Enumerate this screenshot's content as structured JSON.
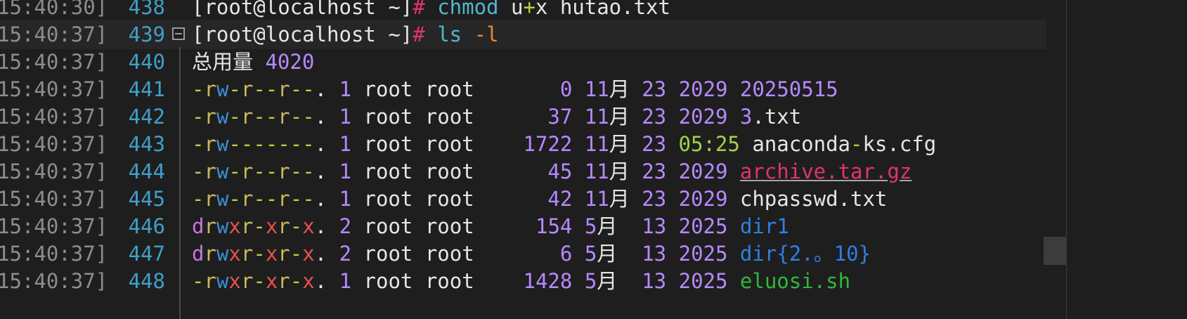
{
  "colors": {
    "background": "#1e1e1e",
    "current_line": "#262626",
    "timestamp": "#8d8d8d",
    "line_number": "#3f9fc8",
    "perm_dash": "#b6d33c",
    "perm_dir": "#c678dd",
    "perm_r": "#c8b95a",
    "perm_w": "#3a8fd8",
    "perm_x": "#e8524a",
    "number": "#b689ff",
    "text": "#e6e6e6",
    "time": "#a3d14b",
    "archive": "#e0346c",
    "directory": "#2f7fe3",
    "executable": "#2fb83a",
    "command": "#51b7cf"
  },
  "icons": {
    "fold": "fold-collapse-icon"
  },
  "lines": [
    {
      "timestamp": "15:40:30]",
      "number": "438",
      "tokens": [
        {
          "t": "[root@localhost ~]",
          "c": "wh"
        },
        {
          "t": "#",
          "c": "red"
        },
        {
          "t": " ",
          "c": "wh"
        },
        {
          "t": "chmod",
          "c": "cyan"
        },
        {
          "t": " u",
          "c": "wh"
        },
        {
          "t": "+",
          "c": "dash"
        },
        {
          "t": "x hutao.txt",
          "c": "wh"
        }
      ]
    },
    {
      "timestamp": "15:40:37]",
      "number": "439",
      "current": true,
      "tokens": [
        {
          "t": "[root@localhost ~]",
          "c": "wh"
        },
        {
          "t": "#",
          "c": "red"
        },
        {
          "t": " ",
          "c": "wh"
        },
        {
          "t": "ls",
          "c": "cyan"
        },
        {
          "t": " ",
          "c": "wh"
        },
        {
          "t": "-l",
          "c": "orange"
        }
      ]
    },
    {
      "timestamp": "15:40:37]",
      "number": "440",
      "tokens": [
        {
          "t": "总用量 ",
          "c": "wh"
        },
        {
          "t": "4020",
          "c": "pu"
        }
      ]
    },
    {
      "timestamp": "15:40:37]",
      "number": "441",
      "tokens": [
        {
          "t": "-",
          "c": "dash"
        },
        {
          "t": "r",
          "c": "r"
        },
        {
          "t": "w",
          "c": "w"
        },
        {
          "t": "-",
          "c": "dash"
        },
        {
          "t": "r",
          "c": "r"
        },
        {
          "t": "--",
          "c": "dash"
        },
        {
          "t": "r",
          "c": "r"
        },
        {
          "t": "--",
          "c": "dash"
        },
        {
          "t": ". ",
          "c": "wh"
        },
        {
          "t": "1",
          "c": "pu"
        },
        {
          "t": " root root       ",
          "c": "wh"
        },
        {
          "t": "0",
          "c": "pu"
        },
        {
          "t": " ",
          "c": "wh"
        },
        {
          "t": "11",
          "c": "pu"
        },
        {
          "t": "月 ",
          "c": "wh"
        },
        {
          "t": "23",
          "c": "pu"
        },
        {
          "t": " ",
          "c": "wh"
        },
        {
          "t": "2029",
          "c": "pu"
        },
        {
          "t": " ",
          "c": "wh"
        },
        {
          "t": "20250515",
          "c": "pu"
        }
      ]
    },
    {
      "timestamp": "15:40:37]",
      "number": "442",
      "tokens": [
        {
          "t": "-",
          "c": "dash"
        },
        {
          "t": "r",
          "c": "r"
        },
        {
          "t": "w",
          "c": "w"
        },
        {
          "t": "-",
          "c": "dash"
        },
        {
          "t": "r",
          "c": "r"
        },
        {
          "t": "--",
          "c": "dash"
        },
        {
          "t": "r",
          "c": "r"
        },
        {
          "t": "--",
          "c": "dash"
        },
        {
          "t": ". ",
          "c": "wh"
        },
        {
          "t": "1",
          "c": "pu"
        },
        {
          "t": " root root      ",
          "c": "wh"
        },
        {
          "t": "37",
          "c": "pu"
        },
        {
          "t": " ",
          "c": "wh"
        },
        {
          "t": "11",
          "c": "pu"
        },
        {
          "t": "月 ",
          "c": "wh"
        },
        {
          "t": "23",
          "c": "pu"
        },
        {
          "t": " ",
          "c": "wh"
        },
        {
          "t": "2029",
          "c": "pu"
        },
        {
          "t": " ",
          "c": "wh"
        },
        {
          "t": "3",
          "c": "pu"
        },
        {
          "t": ".txt",
          "c": "wh"
        }
      ]
    },
    {
      "timestamp": "15:40:37]",
      "number": "443",
      "tokens": [
        {
          "t": "-",
          "c": "dash"
        },
        {
          "t": "r",
          "c": "r"
        },
        {
          "t": "w",
          "c": "w"
        },
        {
          "t": "-------",
          "c": "dash"
        },
        {
          "t": ". ",
          "c": "wh"
        },
        {
          "t": "1",
          "c": "pu"
        },
        {
          "t": " root root    ",
          "c": "wh"
        },
        {
          "t": "1722",
          "c": "pu"
        },
        {
          "t": " ",
          "c": "wh"
        },
        {
          "t": "11",
          "c": "pu"
        },
        {
          "t": "月 ",
          "c": "wh"
        },
        {
          "t": "23",
          "c": "pu"
        },
        {
          "t": " ",
          "c": "wh"
        },
        {
          "t": "05:25",
          "c": "gr"
        },
        {
          "t": " anaconda",
          "c": "wh"
        },
        {
          "t": "-",
          "c": "dash"
        },
        {
          "t": "ks.cfg",
          "c": "wh"
        }
      ]
    },
    {
      "timestamp": "15:40:37]",
      "number": "444",
      "tokens": [
        {
          "t": "-",
          "c": "dash"
        },
        {
          "t": "r",
          "c": "r"
        },
        {
          "t": "w",
          "c": "w"
        },
        {
          "t": "-",
          "c": "dash"
        },
        {
          "t": "r",
          "c": "r"
        },
        {
          "t": "--",
          "c": "dash"
        },
        {
          "t": "r",
          "c": "r"
        },
        {
          "t": "--",
          "c": "dash"
        },
        {
          "t": ". ",
          "c": "wh"
        },
        {
          "t": "1",
          "c": "pu"
        },
        {
          "t": " root root      ",
          "c": "wh"
        },
        {
          "t": "45",
          "c": "pu"
        },
        {
          "t": " ",
          "c": "wh"
        },
        {
          "t": "11",
          "c": "pu"
        },
        {
          "t": "月 ",
          "c": "wh"
        },
        {
          "t": "23",
          "c": "pu"
        },
        {
          "t": " ",
          "c": "wh"
        },
        {
          "t": "2029",
          "c": "pu"
        },
        {
          "t": " ",
          "c": "wh"
        },
        {
          "t": "archive.tar.gz",
          "c": "pink"
        }
      ]
    },
    {
      "timestamp": "15:40:37]",
      "number": "445",
      "tokens": [
        {
          "t": "-",
          "c": "dash"
        },
        {
          "t": "r",
          "c": "r"
        },
        {
          "t": "w",
          "c": "w"
        },
        {
          "t": "-",
          "c": "dash"
        },
        {
          "t": "r",
          "c": "r"
        },
        {
          "t": "--",
          "c": "dash"
        },
        {
          "t": "r",
          "c": "r"
        },
        {
          "t": "--",
          "c": "dash"
        },
        {
          "t": ". ",
          "c": "wh"
        },
        {
          "t": "1",
          "c": "pu"
        },
        {
          "t": " root root      ",
          "c": "wh"
        },
        {
          "t": "42",
          "c": "pu"
        },
        {
          "t": " ",
          "c": "wh"
        },
        {
          "t": "11",
          "c": "pu"
        },
        {
          "t": "月 ",
          "c": "wh"
        },
        {
          "t": "23",
          "c": "pu"
        },
        {
          "t": " ",
          "c": "wh"
        },
        {
          "t": "2029",
          "c": "pu"
        },
        {
          "t": " chpasswd.txt",
          "c": "wh"
        }
      ]
    },
    {
      "timestamp": "15:40:37]",
      "number": "446",
      "tokens": [
        {
          "t": "d",
          "c": "dir"
        },
        {
          "t": "r",
          "c": "r"
        },
        {
          "t": "w",
          "c": "w"
        },
        {
          "t": "x",
          "c": "x"
        },
        {
          "t": "r",
          "c": "r"
        },
        {
          "t": "-",
          "c": "dash"
        },
        {
          "t": "x",
          "c": "x"
        },
        {
          "t": "r",
          "c": "r"
        },
        {
          "t": "-",
          "c": "dash"
        },
        {
          "t": "x",
          "c": "x"
        },
        {
          "t": ". ",
          "c": "wh"
        },
        {
          "t": "2",
          "c": "pu"
        },
        {
          "t": " root root     ",
          "c": "wh"
        },
        {
          "t": "154",
          "c": "pu"
        },
        {
          "t": " ",
          "c": "wh"
        },
        {
          "t": "5",
          "c": "pu"
        },
        {
          "t": "月  ",
          "c": "wh"
        },
        {
          "t": "13",
          "c": "pu"
        },
        {
          "t": " ",
          "c": "wh"
        },
        {
          "t": "2025",
          "c": "pu"
        },
        {
          "t": " ",
          "c": "wh"
        },
        {
          "t": "dir1",
          "c": "blue"
        }
      ]
    },
    {
      "timestamp": "15:40:37]",
      "number": "447",
      "tokens": [
        {
          "t": "d",
          "c": "dir"
        },
        {
          "t": "r",
          "c": "r"
        },
        {
          "t": "w",
          "c": "w"
        },
        {
          "t": "x",
          "c": "x"
        },
        {
          "t": "r",
          "c": "r"
        },
        {
          "t": "-",
          "c": "dash"
        },
        {
          "t": "x",
          "c": "x"
        },
        {
          "t": "r",
          "c": "r"
        },
        {
          "t": "-",
          "c": "dash"
        },
        {
          "t": "x",
          "c": "x"
        },
        {
          "t": ". ",
          "c": "wh"
        },
        {
          "t": "2",
          "c": "pu"
        },
        {
          "t": " root root       ",
          "c": "wh"
        },
        {
          "t": "6",
          "c": "pu"
        },
        {
          "t": " ",
          "c": "wh"
        },
        {
          "t": "5",
          "c": "pu"
        },
        {
          "t": "月  ",
          "c": "wh"
        },
        {
          "t": "13",
          "c": "pu"
        },
        {
          "t": " ",
          "c": "wh"
        },
        {
          "t": "2025",
          "c": "pu"
        },
        {
          "t": " ",
          "c": "wh"
        },
        {
          "t": "dir{2.。10}",
          "c": "blue"
        }
      ]
    },
    {
      "timestamp": "15:40:37]",
      "number": "448",
      "tokens": [
        {
          "t": "-",
          "c": "dash"
        },
        {
          "t": "r",
          "c": "r"
        },
        {
          "t": "w",
          "c": "w"
        },
        {
          "t": "x",
          "c": "x"
        },
        {
          "t": "r",
          "c": "r"
        },
        {
          "t": "-",
          "c": "dash"
        },
        {
          "t": "x",
          "c": "x"
        },
        {
          "t": "r",
          "c": "r"
        },
        {
          "t": "-",
          "c": "dash"
        },
        {
          "t": "x",
          "c": "x"
        },
        {
          "t": ". ",
          "c": "wh"
        },
        {
          "t": "1",
          "c": "pu"
        },
        {
          "t": " root root    ",
          "c": "wh"
        },
        {
          "t": "1428",
          "c": "pu"
        },
        {
          "t": " ",
          "c": "wh"
        },
        {
          "t": "5",
          "c": "pu"
        },
        {
          "t": "月  ",
          "c": "wh"
        },
        {
          "t": "13",
          "c": "pu"
        },
        {
          "t": " ",
          "c": "wh"
        },
        {
          "t": "2025",
          "c": "pu"
        },
        {
          "t": " ",
          "c": "wh"
        },
        {
          "t": "eluosi.sh",
          "c": "green"
        }
      ]
    }
  ]
}
